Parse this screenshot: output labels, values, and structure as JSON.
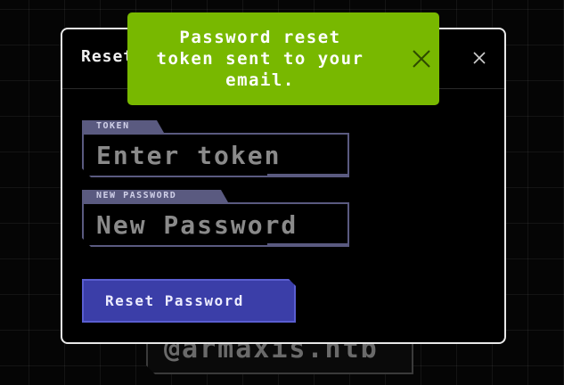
{
  "background": {
    "email_text": "@armaxis.htb"
  },
  "modal": {
    "title": "Reset Password",
    "close_icon": "close-icon",
    "token": {
      "label": "TOKEN",
      "placeholder": "Enter token",
      "value": ""
    },
    "new_password": {
      "label": "NEW PASSWORD",
      "placeholder": "New Password",
      "value": ""
    },
    "submit_label": "Reset Password"
  },
  "toast": {
    "message": "Password reset token sent to your email.",
    "close_icon": "close-icon",
    "color": "#78b800"
  },
  "colors": {
    "accent": "#3b3ea8",
    "field_border": "#5a5a80",
    "success": "#78b800"
  }
}
